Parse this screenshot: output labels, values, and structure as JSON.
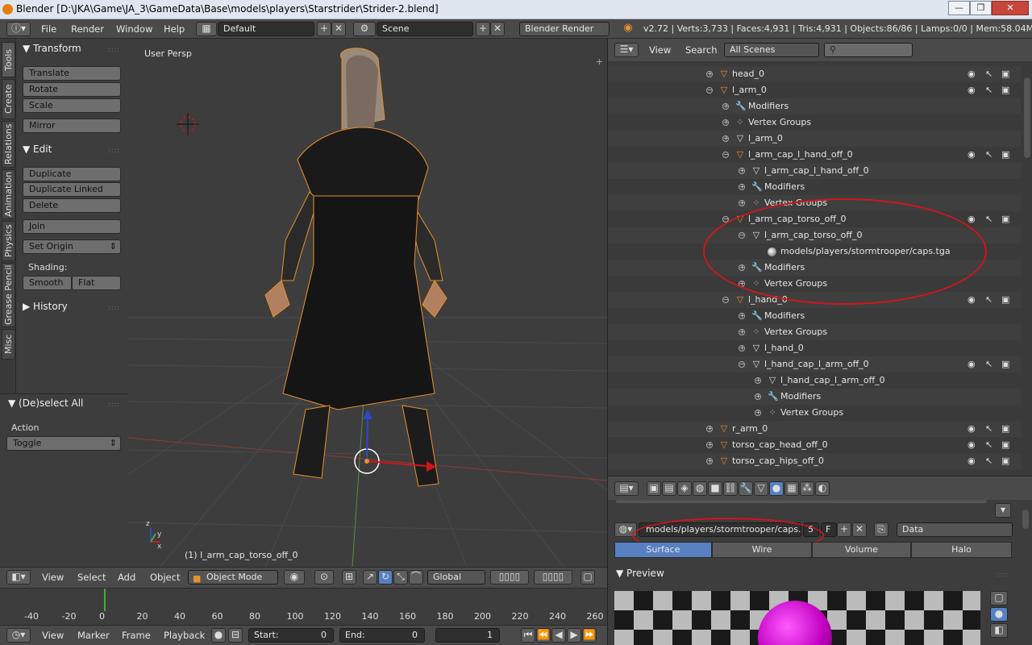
{
  "window": {
    "title": "Blender [D:\\JKA\\Game\\JA_3\\GameData\\Base\\models\\players\\Starstrider\\Strider-2.blend]",
    "buttons": [
      "—",
      "❐",
      "✕"
    ]
  },
  "info_header": {
    "menus": [
      "File",
      "Render",
      "Window",
      "Help"
    ],
    "layout": "Default",
    "scene": "Scene",
    "engine": "Blender Render",
    "stats": "v2.72 | Verts:3,733 | Faces:4,931 | Tris:4,931 | Objects:86/86 | Lamps:0/0 | Mem:58.04M | l_"
  },
  "tool_tabs": [
    "Tools",
    "Create",
    "Relations",
    "Animation",
    "Physics",
    "Grease Pencil",
    "Misc"
  ],
  "tool_shelf": {
    "transform": {
      "header": "Transform",
      "buttons": [
        "Translate",
        "Rotate",
        "Scale",
        "Mirror"
      ]
    },
    "edit": {
      "header": "Edit",
      "buttons": [
        "Duplicate",
        "Duplicate Linked",
        "Delete",
        "Join",
        "Set Origin"
      ]
    },
    "shading": {
      "label": "Shading:",
      "smooth": "Smooth",
      "flat": "Flat"
    },
    "history": "History"
  },
  "operator": {
    "header": "(De)select All",
    "action_label": "Action",
    "action_value": "Toggle"
  },
  "viewport": {
    "view_name": "User Persp",
    "status": "(1) l_arm_cap_torso_off_0"
  },
  "view3d_header": {
    "menus": [
      "View",
      "Select",
      "Add",
      "Object"
    ],
    "mode": "Object Mode",
    "orientation": "Global"
  },
  "timeline": {
    "ticks": [
      "-40",
      "-20",
      "0",
      "20",
      "40",
      "60",
      "80",
      "100",
      "120",
      "140",
      "160",
      "180",
      "200",
      "220",
      "240",
      "260"
    ],
    "menus": [
      "View",
      "Marker",
      "Frame",
      "Playback"
    ],
    "start_label": "Start:",
    "start": "0",
    "end_label": "End:",
    "end": "0",
    "current": "1"
  },
  "outliner": {
    "menus": [
      "View",
      "Search"
    ],
    "scenes": "All Scenes",
    "rows": [
      {
        "label": "head_0",
        "indent": 0,
        "icon": "obj",
        "exp": "+",
        "vis": true
      },
      {
        "label": "l_arm_0",
        "indent": 0,
        "icon": "obj",
        "exp": "−",
        "vis": true
      },
      {
        "label": "Modifiers",
        "indent": 1,
        "icon": "mod",
        "exp": "+",
        "vis": false
      },
      {
        "label": "Vertex Groups",
        "indent": 1,
        "icon": "vg",
        "exp": "+",
        "vis": false
      },
      {
        "label": "l_arm_0",
        "indent": 1,
        "icon": "mesh",
        "exp": "+",
        "vis": false
      },
      {
        "label": "l_arm_cap_l_hand_off_0",
        "indent": 1,
        "icon": "obj",
        "exp": "−",
        "vis": true
      },
      {
        "label": "l_arm_cap_l_hand_off_0",
        "indent": 2,
        "icon": "mesh",
        "exp": "+",
        "vis": false
      },
      {
        "label": "Modifiers",
        "indent": 2,
        "icon": "mod",
        "exp": "+",
        "vis": false
      },
      {
        "label": "Vertex Groups",
        "indent": 2,
        "icon": "vg",
        "exp": "+",
        "vis": false
      },
      {
        "label": "l_arm_cap_torso_off_0",
        "indent": 1,
        "icon": "obj",
        "exp": "−",
        "vis": true
      },
      {
        "label": "l_arm_cap_torso_off_0",
        "indent": 2,
        "icon": "mesh",
        "exp": "−",
        "vis": false
      },
      {
        "label": "models/players/stormtrooper/caps.tga",
        "indent": 3,
        "icon": "mat",
        "exp": "",
        "vis": false
      },
      {
        "label": "Modifiers",
        "indent": 2,
        "icon": "mod",
        "exp": "+",
        "vis": false
      },
      {
        "label": "Vertex Groups",
        "indent": 2,
        "icon": "vg",
        "exp": "+",
        "vis": false
      },
      {
        "label": "l_hand_0",
        "indent": 1,
        "icon": "obj",
        "exp": "−",
        "vis": true
      },
      {
        "label": "Modifiers",
        "indent": 2,
        "icon": "mod",
        "exp": "+",
        "vis": false
      },
      {
        "label": "Vertex Groups",
        "indent": 2,
        "icon": "vg",
        "exp": "+",
        "vis": false
      },
      {
        "label": "l_hand_0",
        "indent": 2,
        "icon": "mesh",
        "exp": "+",
        "vis": false
      },
      {
        "label": "l_hand_cap_l_arm_off_0",
        "indent": 2,
        "icon": "mesh",
        "exp": "−",
        "vis": true
      },
      {
        "label": "l_hand_cap_l_arm_off_0",
        "indent": 3,
        "icon": "mesh",
        "exp": "+",
        "vis": false
      },
      {
        "label": "Modifiers",
        "indent": 3,
        "icon": "mod",
        "exp": "+",
        "vis": false
      },
      {
        "label": "Vertex Groups",
        "indent": 3,
        "icon": "vg",
        "exp": "+",
        "vis": false
      },
      {
        "label": "r_arm_0",
        "indent": 0,
        "icon": "obj",
        "exp": "+",
        "vis": true
      },
      {
        "label": "torso_cap_head_off_0",
        "indent": 0,
        "icon": "obj",
        "exp": "+",
        "vis": true
      },
      {
        "label": "torso_cap_hips_off_0",
        "indent": 0,
        "icon": "obj",
        "exp": "+",
        "vis": true
      }
    ]
  },
  "properties": {
    "material_name": "models/players/stormtrooper/caps.tga",
    "users": "5",
    "fake": "F",
    "link": "Data",
    "tabs": [
      "Surface",
      "Wire",
      "Volume",
      "Halo"
    ],
    "preview": "Preview"
  },
  "colors": {
    "accent": "#5680c2",
    "selection": "#e8902c",
    "annotation": "#d0161c"
  }
}
